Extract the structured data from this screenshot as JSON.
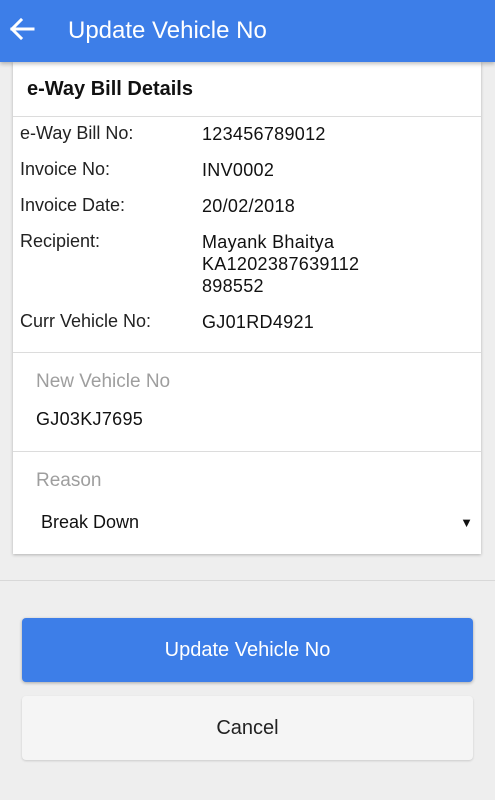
{
  "appbar": {
    "title": "Update Vehicle No",
    "back_icon": "arrow-left-icon",
    "color": "#3d7ee8"
  },
  "card": {
    "header": "e-Way Bill Details",
    "details": [
      {
        "label": "e-Way Bill No:",
        "value": "123456789012"
      },
      {
        "label": "Invoice No:",
        "value": "INV0002"
      },
      {
        "label": "Invoice Date:",
        "value": "20/02/2018"
      },
      {
        "label": "Recipient:",
        "value_lines": [
          "Mayank Bhaitya",
          "KA1202387639112",
          "898552"
        ]
      },
      {
        "label": "Curr Vehicle No:",
        "value": "GJ01RD4921"
      }
    ],
    "new_vehicle": {
      "label": "New Vehicle No",
      "value": "GJ03KJ7695"
    },
    "reason": {
      "label": "Reason",
      "selected": "Break Down",
      "dropdown_icon": "caret-down-icon"
    }
  },
  "actions": {
    "update_label": "Update Vehicle No",
    "cancel_label": "Cancel"
  }
}
